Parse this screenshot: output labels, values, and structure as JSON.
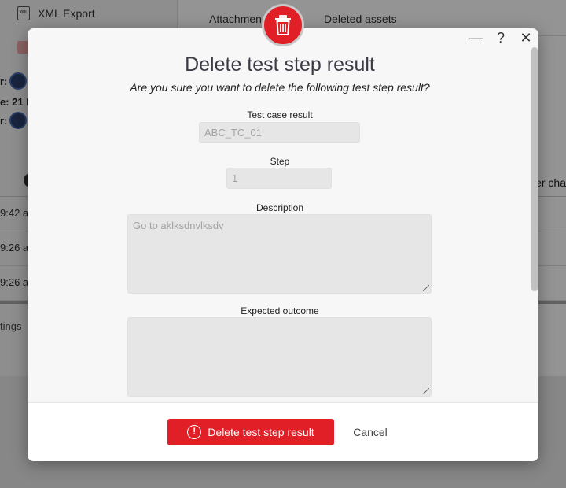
{
  "background": {
    "sidebar_item": "XML Export",
    "xml_icon_text": "XML",
    "fields": [
      {
        "label": "r:"
      },
      {
        "label": "e: 21 N"
      },
      {
        "label": "r:"
      }
    ],
    "tabs": [
      "Attachmen",
      "Deleted assets"
    ],
    "column_header": "er cha",
    "rows": [
      "9:42 a",
      "9:26 a",
      "9:26 a"
    ],
    "settings": "tings"
  },
  "dialog": {
    "title": "Delete test step result",
    "subtitle": "Are you sure you want to delete the following test step result?",
    "window_controls": {
      "minimize": "—",
      "help": "?",
      "close": "✕"
    },
    "fields": {
      "test_case_result": {
        "label": "Test case result",
        "value": "ABC_TC_01"
      },
      "step": {
        "label": "Step",
        "value": "1"
      },
      "description": {
        "label": "Description",
        "value": "Go to aklksdnvlksdv"
      },
      "expected_outcome": {
        "label": "Expected outcome",
        "value": ""
      }
    },
    "delete_button": "Delete test step result",
    "delete_icon_glyph": "!",
    "cancel_button": "Cancel"
  },
  "colors": {
    "accent_red": "#e01f26",
    "title_text": "#3b3b45",
    "input_bg": "#e6e6e6"
  },
  "icons": [
    "trash-icon",
    "xml-export-icon",
    "warning-icon",
    "minimize-icon",
    "help-icon",
    "close-icon"
  ]
}
